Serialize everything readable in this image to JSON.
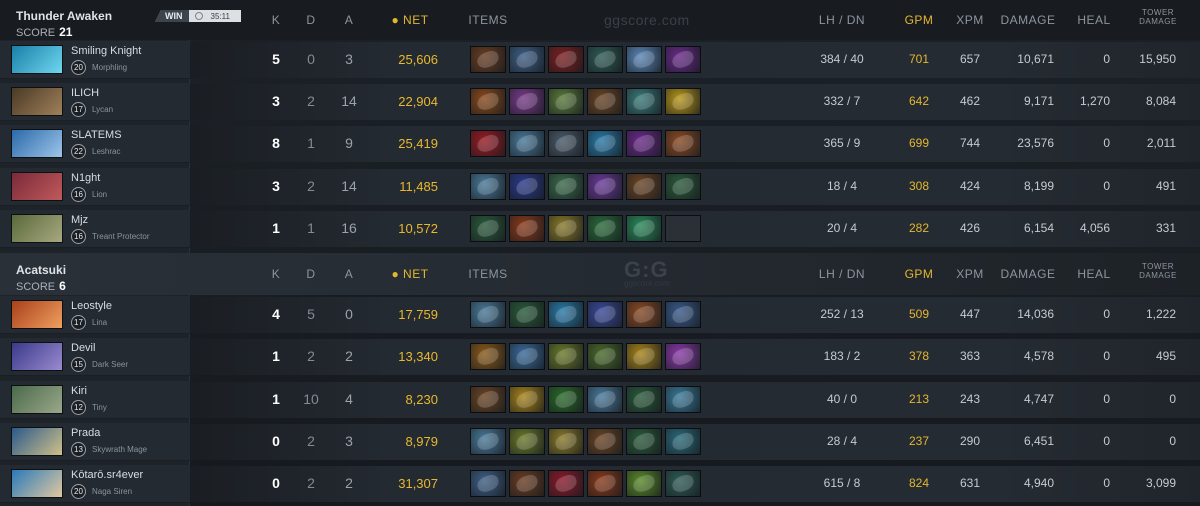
{
  "header_columns": {
    "k": "K",
    "d": "D",
    "a": "A",
    "net": "NET",
    "items": "ITEMS",
    "lh_dn": "LH / DN",
    "gpm": "GPM",
    "xpm": "XPM",
    "damage": "DAMAGE",
    "heal": "HEAL",
    "tower_damage_1": "TOWER",
    "tower_damage_2": "DAMAGE"
  },
  "watermarks": {
    "top": "ggscore.com",
    "logo": "G:G",
    "logo_sub": "ggscore.com"
  },
  "match": {
    "result": "WIN",
    "duration": "35:11"
  },
  "colors": {
    "gold": "#e4b630",
    "net_gold": "#e8b92e",
    "panel": "#242a31"
  },
  "teams": [
    {
      "name": "Thunder Awaken",
      "score_label": "SCORE",
      "score": "21",
      "players": [
        {
          "name": "Smiling Knight",
          "level": "20",
          "hero": "Morphling",
          "k": "5",
          "d": "0",
          "a": "3",
          "net": "25,606",
          "lh_dn": "384 / 40",
          "gpm": "701",
          "xpm": "657",
          "damage": "10,671",
          "heal": "0",
          "tower": "15,950",
          "portrait": [
            "#1a7fa8",
            "#6fd7f0"
          ],
          "items": [
            "#6a3d22",
            "#3e5f86",
            "#7d2020",
            "#2f5b55",
            "#5b87b8",
            "#6a2a8a"
          ]
        },
        {
          "name": "ILICH",
          "level": "17",
          "hero": "Lycan",
          "k": "3",
          "d": "2",
          "a": "14",
          "net": "22,904",
          "lh_dn": "332 / 7",
          "gpm": "642",
          "xpm": "462",
          "damage": "9,171",
          "heal": "1,270",
          "tower": "8,084",
          "portrait": [
            "#4a3a26",
            "#a0805a"
          ],
          "items": [
            "#8a4a1c",
            "#7a3a8c",
            "#5a7a3a",
            "#6a4424",
            "#3a7a7a",
            "#b8961a"
          ]
        },
        {
          "name": "SLATEMS",
          "level": "22",
          "hero": "Leshrac",
          "k": "8",
          "d": "1",
          "a": "9",
          "net": "25,419",
          "lh_dn": "365 / 9",
          "gpm": "699",
          "xpm": "744",
          "damage": "23,576",
          "heal": "0",
          "tower": "2,011",
          "portrait": [
            "#2a6aa8",
            "#9ec4ea"
          ],
          "items": [
            "#9a1a24",
            "#4a7a9a",
            "#4a5a6a",
            "#2a7aa8",
            "#6a2a8a",
            "#8a4a24"
          ]
        },
        {
          "name": "N1ght",
          "level": "16",
          "hero": "Lion",
          "k": "3",
          "d": "2",
          "a": "14",
          "net": "11,485",
          "lh_dn": "18 / 4",
          "gpm": "308",
          "xpm": "424",
          "damage": "8,199",
          "heal": "0",
          "tower": "491",
          "portrait": [
            "#7a2a3a",
            "#c05a5a"
          ],
          "items": [
            "#4a7a9a",
            "#2a3a8a",
            "#3a6a4a",
            "#6a3a9a",
            "#6a4424",
            "#2a5a3a"
          ]
        },
        {
          "name": "Mjz",
          "level": "16",
          "hero": "Treant Protector",
          "k": "1",
          "d": "1",
          "a": "16",
          "net": "10,572",
          "lh_dn": "20 / 4",
          "gpm": "282",
          "xpm": "426",
          "damage": "6,154",
          "heal": "4,056",
          "tower": "331",
          "portrait": [
            "#5a6a3a",
            "#a8a880"
          ],
          "items": [
            "#2a5a3a",
            "#8a3a1a",
            "#8a7a2a",
            "#2a6a3a",
            "#2a8a5a",
            "empty"
          ]
        }
      ]
    },
    {
      "name": "Acatsuki",
      "score_label": "SCORE",
      "score": "6",
      "players": [
        {
          "name": "Leostyle",
          "level": "17",
          "hero": "Lina",
          "k": "4",
          "d": "5",
          "a": "0",
          "net": "17,759",
          "lh_dn": "252 / 13",
          "gpm": "509",
          "xpm": "447",
          "damage": "14,036",
          "heal": "0",
          "tower": "1,222",
          "portrait": [
            "#a8401a",
            "#f0a060"
          ],
          "items": [
            "#4a7a9a",
            "#2a5a3a",
            "#2a7aa8",
            "#3a4a9a",
            "#8a4a24",
            "#3a5a8a"
          ]
        },
        {
          "name": "Devil",
          "level": "15",
          "hero": "Dark Seer",
          "k": "1",
          "d": "2",
          "a": "2",
          "net": "13,340",
          "lh_dn": "183 / 2",
          "gpm": "378",
          "xpm": "363",
          "damage": "4,578",
          "heal": "0",
          "tower": "495",
          "portrait": [
            "#3a3a8a",
            "#9a8ad0"
          ],
          "items": [
            "#8a5a1a",
            "#3a6a9a",
            "#6a7a2a",
            "#4a6a2a",
            "#a8841a",
            "#8a3aa8"
          ]
        },
        {
          "name": "Kiri",
          "level": "12",
          "hero": "Tiny",
          "k": "1",
          "d": "10",
          "a": "4",
          "net": "8,230",
          "lh_dn": "40 / 0",
          "gpm": "213",
          "xpm": "243",
          "damage": "4,747",
          "heal": "0",
          "tower": "0",
          "portrait": [
            "#4a6a4a",
            "#9aa88a"
          ],
          "items": [
            "#6a4424",
            "#a8841a",
            "#2a6a2a",
            "#4a7a9a",
            "#2a5a3a",
            "#3a7a9a"
          ]
        },
        {
          "name": "Prada",
          "level": "13",
          "hero": "Skywrath Mage",
          "k": "0",
          "d": "2",
          "a": "3",
          "net": "8,979",
          "lh_dn": "28 / 4",
          "gpm": "237",
          "xpm": "290",
          "damage": "6,451",
          "heal": "0",
          "tower": "0",
          "portrait": [
            "#2a5a8a",
            "#d0c08a"
          ],
          "items": [
            "#4a7a9a",
            "#6a7a2a",
            "#8a7a2a",
            "#6a4424",
            "#2a5a3a",
            "#2a6a7a"
          ]
        },
        {
          "name": "Kōtarō.sr4ever",
          "level": "20",
          "hero": "Naga Siren",
          "k": "0",
          "d": "2",
          "a": "2",
          "net": "31,307",
          "lh_dn": "615 / 8",
          "gpm": "824",
          "xpm": "631",
          "damage": "4,940",
          "heal": "0",
          "tower": "3,099",
          "portrait": [
            "#2a7ab8",
            "#e0c8a0"
          ],
          "items": [
            "#3e5f86",
            "#6a3d22",
            "#8a1a2a",
            "#8a3a1a",
            "#5a8a2a",
            "#2f5b55"
          ]
        }
      ]
    }
  ]
}
